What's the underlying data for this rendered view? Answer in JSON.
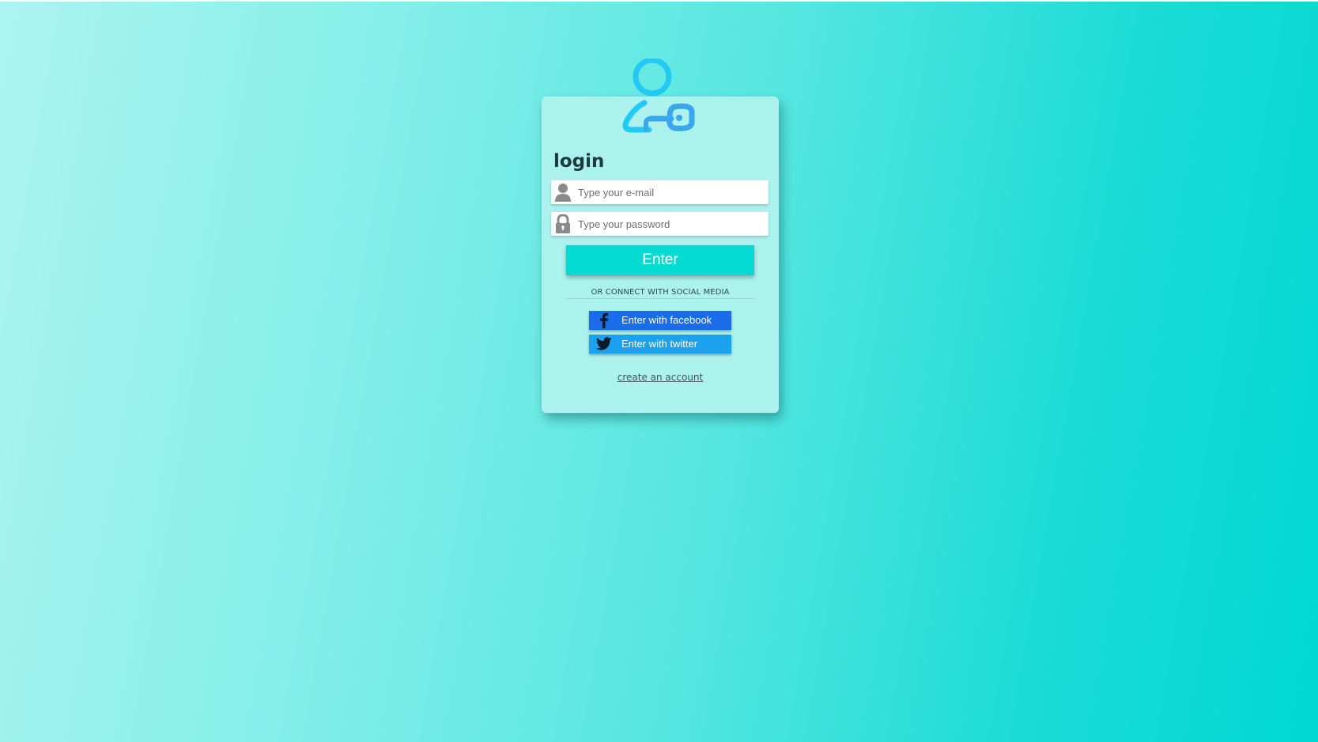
{
  "page": {
    "background_colors": [
      "#abf4f1",
      "#00d8d3"
    ]
  },
  "login_card": {
    "logo_icon": "user-key-icon",
    "logo_color": "#20c8f0",
    "title": "login",
    "email": {
      "icon": "user-icon",
      "placeholder": "Type your e-mail",
      "value": ""
    },
    "password": {
      "icon": "lock-icon",
      "placeholder": "Type your password",
      "value": ""
    },
    "enter_label": "Enter",
    "enter_color": "#05dbd3",
    "social_divider": "OR CONNECT WITH SOCIAL MEDIA",
    "facebook": {
      "icon": "facebook-icon",
      "label": "Enter with facebook",
      "color": "#1b6ce8"
    },
    "twitter": {
      "icon": "twitter-icon",
      "label": "Enter with twitter",
      "color": "#1ca1ee"
    },
    "create_account": "create an account"
  }
}
